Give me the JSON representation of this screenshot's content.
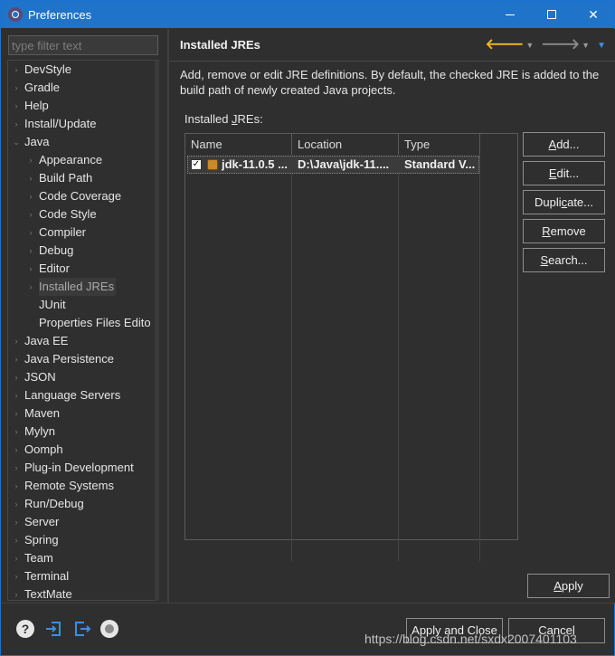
{
  "window": {
    "title": "Preferences"
  },
  "filter": {
    "placeholder": "type filter text"
  },
  "tree": {
    "items": [
      {
        "label": "DevStyle",
        "level": 0,
        "expanded": false
      },
      {
        "label": "Gradle",
        "level": 0,
        "expanded": false
      },
      {
        "label": "Help",
        "level": 0,
        "expanded": false
      },
      {
        "label": "Install/Update",
        "level": 0,
        "expanded": false
      },
      {
        "label": "Java",
        "level": 0,
        "expanded": true
      },
      {
        "label": "Appearance",
        "level": 1,
        "expanded": false
      },
      {
        "label": "Build Path",
        "level": 1,
        "expanded": false
      },
      {
        "label": "Code Coverage",
        "level": 1,
        "expanded": false
      },
      {
        "label": "Code Style",
        "level": 1,
        "expanded": false
      },
      {
        "label": "Compiler",
        "level": 1,
        "expanded": false
      },
      {
        "label": "Debug",
        "level": 1,
        "expanded": false
      },
      {
        "label": "Editor",
        "level": 1,
        "expanded": false
      },
      {
        "label": "Installed JREs",
        "level": 1,
        "expanded": false,
        "selected": true
      },
      {
        "label": "JUnit",
        "level": 1,
        "leaf": true
      },
      {
        "label": "Properties Files Edito",
        "level": 1,
        "leaf": true
      },
      {
        "label": "Java EE",
        "level": 0,
        "expanded": false
      },
      {
        "label": "Java Persistence",
        "level": 0,
        "expanded": false
      },
      {
        "label": "JSON",
        "level": 0,
        "expanded": false
      },
      {
        "label": "Language Servers",
        "level": 0,
        "expanded": false
      },
      {
        "label": "Maven",
        "level": 0,
        "expanded": false
      },
      {
        "label": "Mylyn",
        "level": 0,
        "expanded": false
      },
      {
        "label": "Oomph",
        "level": 0,
        "expanded": false
      },
      {
        "label": "Plug-in Development",
        "level": 0,
        "expanded": false
      },
      {
        "label": "Remote Systems",
        "level": 0,
        "expanded": false
      },
      {
        "label": "Run/Debug",
        "level": 0,
        "expanded": false
      },
      {
        "label": "Server",
        "level": 0,
        "expanded": false
      },
      {
        "label": "Spring",
        "level": 0,
        "expanded": false
      },
      {
        "label": "Team",
        "level": 0,
        "expanded": false
      },
      {
        "label": "Terminal",
        "level": 0,
        "expanded": false
      },
      {
        "label": "TextMate",
        "level": 0,
        "expanded": false
      }
    ]
  },
  "page": {
    "title": "Installed JREs",
    "description": "Add, remove or edit JRE definitions. By default, the checked JRE is added to the build path of newly created Java projects.",
    "installed_label": "Installed JREs:",
    "installed_label_pre": "Installed ",
    "installed_label_mn": "J",
    "installed_label_post": "REs:"
  },
  "table": {
    "columns": [
      "Name",
      "Location",
      "Type"
    ],
    "rows": [
      {
        "checked": true,
        "name": "jdk-11.0.5 ...",
        "location": "D:\\Java\\jdk-11....",
        "type": "Standard V..."
      }
    ]
  },
  "buttons": {
    "add": {
      "pre": "",
      "mn": "A",
      "post": "dd..."
    },
    "edit": {
      "pre": "",
      "mn": "E",
      "post": "dit..."
    },
    "duplicate": {
      "pre": "Dupli",
      "mn": "c",
      "post": "ate..."
    },
    "remove": {
      "pre": "",
      "mn": "R",
      "post": "emove"
    },
    "search": {
      "pre": "",
      "mn": "S",
      "post": "earch..."
    },
    "apply": {
      "pre": "",
      "mn": "A",
      "post": "pply"
    },
    "apply_close": "Apply and Close",
    "cancel": "Cancel"
  },
  "watermark": "https://blog.csdn.net/sxdx2007401103",
  "colors": {
    "titlebar": "#1f73c8",
    "background": "#2f2f2f",
    "accent_back_arrow": "#f2b81a",
    "link_blue": "#3d8fe0"
  }
}
